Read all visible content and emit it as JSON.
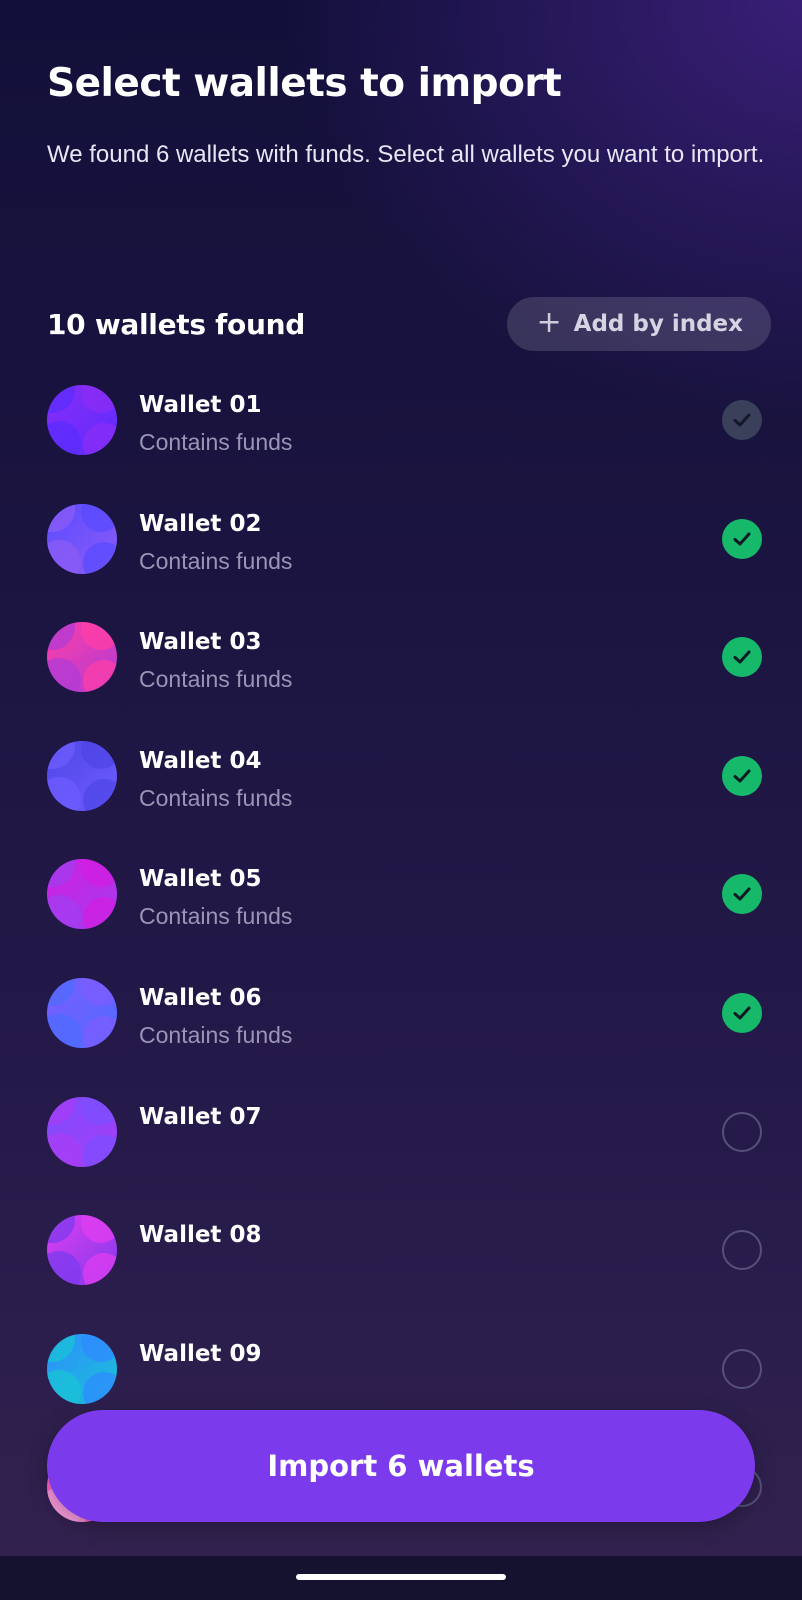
{
  "header": {
    "title": "Select wallets to import",
    "subtitle": "We found 6 wallets with funds. Select all wallets you want to import."
  },
  "found": {
    "label": "10 wallets found",
    "add_button": "Add by index"
  },
  "wallets": [
    {
      "name": "Wallet 01",
      "status": "Contains funds",
      "checked": true,
      "state": "disabled",
      "colors": [
        "#8b2cf5",
        "#5b2cff"
      ]
    },
    {
      "name": "Wallet 02",
      "status": "Contains funds",
      "checked": true,
      "state": "selected",
      "colors": [
        "#5a4bff",
        "#8b5cf6"
      ]
    },
    {
      "name": "Wallet 03",
      "status": "Contains funds",
      "checked": true,
      "state": "selected",
      "colors": [
        "#ff3ea5",
        "#b03bd6"
      ]
    },
    {
      "name": "Wallet 04",
      "status": "Contains funds",
      "checked": true,
      "state": "selected",
      "colors": [
        "#4f46e5",
        "#6d5cff"
      ]
    },
    {
      "name": "Wallet 05",
      "status": "Contains funds",
      "checked": true,
      "state": "selected",
      "colors": [
        "#d11ee0",
        "#a23df0"
      ]
    },
    {
      "name": "Wallet 06",
      "status": "Contains funds",
      "checked": true,
      "state": "selected",
      "colors": [
        "#7c5cff",
        "#4f6bff"
      ]
    },
    {
      "name": "Wallet 07",
      "status": "",
      "checked": false,
      "state": "unselected",
      "colors": [
        "#7c4dff",
        "#a73df5"
      ]
    },
    {
      "name": "Wallet 08",
      "status": "",
      "checked": false,
      "state": "unselected",
      "colors": [
        "#e23ef0",
        "#7c3aed"
      ]
    },
    {
      "name": "Wallet 09",
      "status": "",
      "checked": false,
      "state": "unselected",
      "colors": [
        "#2f8bff",
        "#19c3d6"
      ]
    },
    {
      "name": "",
      "status": "",
      "checked": false,
      "state": "unselected",
      "colors": [
        "#ff4fb3",
        "#f5a3e0"
      ]
    }
  ],
  "import_button": "Import 6 wallets",
  "colors": {
    "accent": "#7c3aed",
    "check_green": "#16b86a"
  }
}
